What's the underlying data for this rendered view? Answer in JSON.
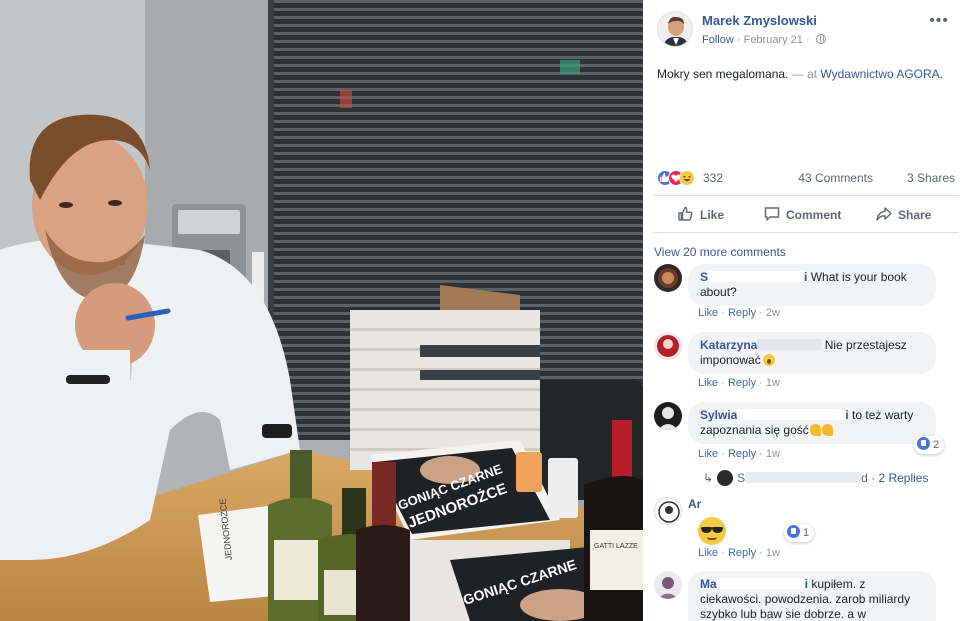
{
  "post": {
    "author": "Marek Zmyslowski",
    "follow_label": "Follow",
    "separator": "·",
    "date": "February 21",
    "more_menu": "•••",
    "caption_text": "Mokry sen megalomana.",
    "caption_at": " — at ",
    "caption_place": "Wydawnictwo AGORA",
    "caption_end": "."
  },
  "photo": {
    "book_title_line1": "GONIĄC CZARNE",
    "book_title_line2": "JEDNOROŻCE",
    "wine_label": "GATTI LAZZE"
  },
  "stats": {
    "reaction_icons": [
      "like-icon",
      "love-icon",
      "haha-icon"
    ],
    "reaction_count": "332",
    "comments": "43 Comments",
    "shares": "3 Shares"
  },
  "actions": {
    "like": "Like",
    "comment": "Comment",
    "share": "Share"
  },
  "comments_section": {
    "view_more": "View 20 more comments",
    "items": [
      {
        "name_start": "S",
        "name_end": "i",
        "text": " What is your book about?",
        "like": "Like",
        "reply": "Reply",
        "time": "2w"
      },
      {
        "name_start": "Katarzyna",
        "name_end": "",
        "text": " Nie przestajesz imponować",
        "emoji": "surprised-emoji",
        "like": "Like",
        "reply": "Reply",
        "time": "1w"
      },
      {
        "name_start": "Sylwia",
        "name_end": "i",
        "text": " to też warty zapoznania się gość",
        "emoji": "muscle-emoji",
        "reaction_count": "2",
        "like": "Like",
        "reply": "Reply",
        "time": "1w"
      },
      {
        "name_start": "Ar",
        "name_end": "",
        "text": "",
        "emoji": "sunglasses-emoji",
        "reaction_count": "1",
        "like": "Like",
        "reply": "Reply",
        "time": "1w"
      },
      {
        "name_start": "Ma",
        "name_end": "i",
        "text": " kupiłem. z ciekawości. powodzenia. zarob miliardy szybko lub baw sie dobrze. a w ciekawych sprawch dzwon."
      }
    ],
    "replies": {
      "author_start": "S",
      "author_end": "d",
      "label": "2 Replies"
    }
  },
  "colors": {
    "link_blue": "#365899",
    "meta_gray": "#90949c",
    "bubble_bg": "#f2f3f5",
    "like_blue": "#4a76d8",
    "love_red": "#f0284a",
    "haha_yellow": "#f7c842"
  }
}
